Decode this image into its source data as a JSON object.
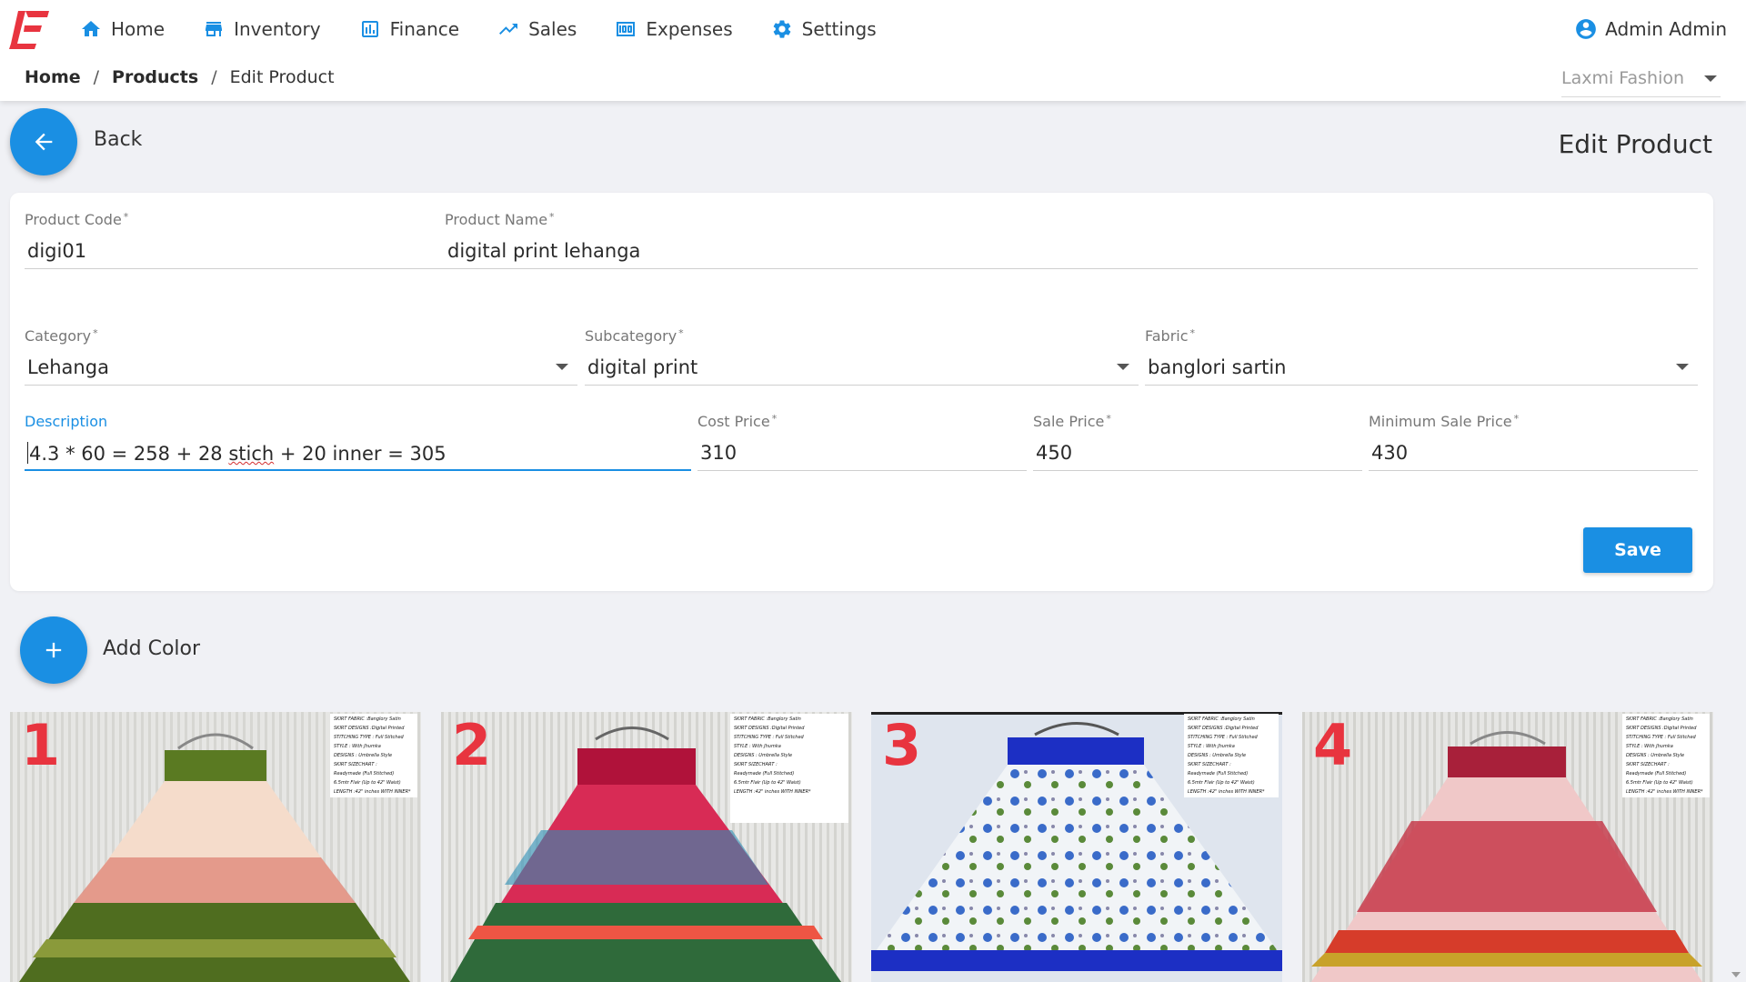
{
  "nav": {
    "items": [
      {
        "label": "Home",
        "icon": "home-icon"
      },
      {
        "label": "Inventory",
        "icon": "store-icon"
      },
      {
        "label": "Finance",
        "icon": "bar-chart-icon"
      },
      {
        "label": "Sales",
        "icon": "trending-up-icon"
      },
      {
        "label": "Expenses",
        "icon": "money-icon"
      },
      {
        "label": "Settings",
        "icon": "gear-icon"
      }
    ],
    "user": "Admin Admin"
  },
  "breadcrumb": {
    "home": "Home",
    "products": "Products",
    "current": "Edit Product",
    "separator": "/"
  },
  "store_select": {
    "value": "Laxmi Fashion"
  },
  "back": {
    "label": "Back"
  },
  "page": {
    "title": "Edit Product"
  },
  "form": {
    "required_mark": "*",
    "product_code": {
      "label": "Product Code",
      "value": "digi01"
    },
    "product_name": {
      "label": "Product Name",
      "value": "digital print lehanga"
    },
    "category": {
      "label": "Category",
      "value": "Lehanga"
    },
    "subcategory": {
      "label": "Subcategory",
      "value": "digital print"
    },
    "fabric": {
      "label": "Fabric",
      "value": "banglori sartin"
    },
    "description": {
      "label": "Description",
      "value_start": "4.3 * 60 = 258 + 28 ",
      "value_misspelled": "stich",
      "value_end": " + 20 inner = 305"
    },
    "cost_price": {
      "label": "Cost Price",
      "value": "310"
    },
    "sale_price": {
      "label": "Sale Price",
      "value": "450"
    },
    "min_sale_price": {
      "label": "Minimum Sale Price",
      "value": "430"
    },
    "save_label": "Save"
  },
  "add_color": {
    "label": "Add Color"
  },
  "images": [
    {
      "number": "1",
      "tag": [
        "SKIRT FABRIC :Banglory Satin",
        "SKIRT DESIGNS :Digital Printed",
        "STITCHING TYPE : Full Stitched",
        "STYLE : With Jhumka",
        "DESIGNS : Umbrella Style",
        "SKIRT SIZECHART :",
        "Readymade (Full Stitched)",
        "6.5mtr Flair (Up to 42\" Waist)",
        "LENGTH :42\" inches WITH INNER*"
      ]
    },
    {
      "number": "2",
      "tag": [
        "SKIRT FABRIC :Banglory Satin",
        "SKIRT DESIGNS :Digital Printed",
        "STITCHING TYPE : Full Stitched",
        "STYLE : With Jhumka",
        "DESIGNS : Umbrella Style",
        "SKIRT SIZECHART :",
        "Readymade (Full Stitched)",
        "6.5mtr Flair (Up to 42\" Waist)",
        "LENGTH :42\" inches WITH INNER*"
      ]
    },
    {
      "number": "3",
      "tag": [
        "SKIRT FABRIC :Banglory Satin",
        "SKIRT DESIGNS :Digital Printed",
        "STITCHING TYPE : Full Stitched",
        "STYLE : With Jhumka",
        "DESIGNS : Umbrella Style",
        "SKIRT SIZECHART :",
        "Readymade (Full Stitched)",
        "6.5mtr Flair (Up to 42\" Waist)",
        "LENGTH :42\" inches WITH INNER*"
      ]
    },
    {
      "number": "4",
      "tag": [
        "SKIRT FABRIC :Banglory Satin",
        "SKIRT DESIGNS :Digital Printed",
        "STITCHING TYPE : Full Stitched",
        "STYLE : With Jhumka",
        "DESIGNS : Umbrella Style",
        "SKIRT SIZECHART :",
        "Readymade (Full Stitched)",
        "6.5mtr Flair (Up to 42\" Waist)",
        "LENGTH :42\" inches WITH INNER*"
      ]
    }
  ],
  "colors": {
    "accent": "#1a8fe3",
    "logo": "#e8343f",
    "number_overlay": "#e8343f"
  }
}
